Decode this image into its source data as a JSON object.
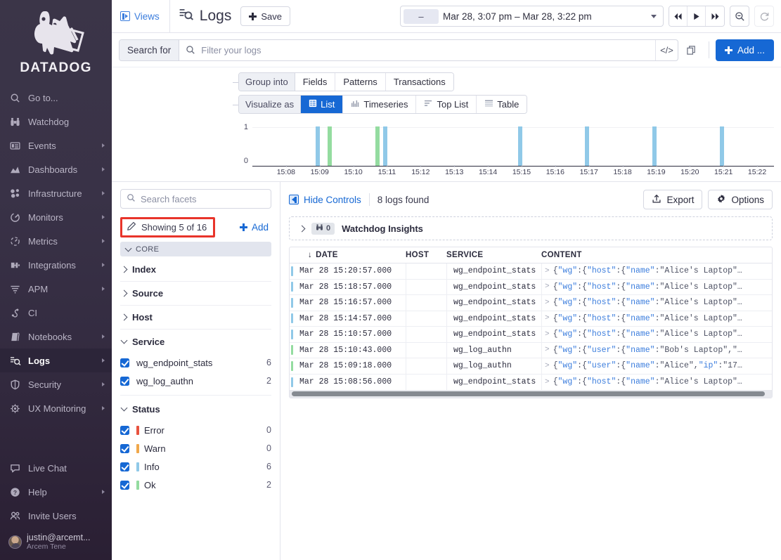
{
  "sidebar": {
    "brand": "DATADOG",
    "items": [
      {
        "label": "Go to...",
        "icon": "search-icon",
        "caret": false,
        "active": false
      },
      {
        "label": "Watchdog",
        "icon": "binoculars-icon",
        "caret": false,
        "active": false
      },
      {
        "label": "Events",
        "icon": "events-icon",
        "caret": true,
        "active": false
      },
      {
        "label": "Dashboards",
        "icon": "dashboards-icon",
        "caret": true,
        "active": false
      },
      {
        "label": "Infrastructure",
        "icon": "infrastructure-icon",
        "caret": true,
        "active": false
      },
      {
        "label": "Monitors",
        "icon": "monitors-icon",
        "caret": true,
        "active": false
      },
      {
        "label": "Metrics",
        "icon": "metrics-icon",
        "caret": true,
        "active": false
      },
      {
        "label": "Integrations",
        "icon": "integrations-icon",
        "caret": true,
        "active": false
      },
      {
        "label": "APM",
        "icon": "apm-icon",
        "caret": true,
        "active": false
      },
      {
        "label": "CI",
        "icon": "ci-icon",
        "caret": false,
        "active": false
      },
      {
        "label": "Notebooks",
        "icon": "notebooks-icon",
        "caret": true,
        "active": false
      },
      {
        "label": "Logs",
        "icon": "logs-icon",
        "caret": true,
        "active": true
      },
      {
        "label": "Security",
        "icon": "shield-icon",
        "caret": true,
        "active": false
      },
      {
        "label": "UX Monitoring",
        "icon": "ux-monitoring-icon",
        "caret": true,
        "active": false
      }
    ],
    "bottom_items": [
      {
        "label": "Live Chat",
        "icon": "chat-icon",
        "caret": false
      },
      {
        "label": "Help",
        "icon": "help-icon",
        "caret": true
      },
      {
        "label": "Invite Users",
        "icon": "invite-users-icon",
        "caret": false
      }
    ],
    "user": {
      "email": "justin@arcemt...",
      "org": "Arcem Tene"
    }
  },
  "topbar": {
    "views_label": "Views",
    "page_title": "Logs",
    "save_label": "Save",
    "time_range_dash": "–",
    "time_range": "Mar 28, 3:07 pm – Mar 28, 3:22 pm"
  },
  "search": {
    "label": "Search for",
    "placeholder": "Filter your logs",
    "value": "",
    "code_icon": "</>",
    "add_label": "Add ..."
  },
  "controls": {
    "group_lead": "Group into",
    "group_options": [
      "Fields",
      "Patterns",
      "Transactions"
    ],
    "group_selected": "",
    "visualize_lead": "Visualize as",
    "visualize_options": [
      {
        "label": "List",
        "icon": "list-icon",
        "selected": true
      },
      {
        "label": "Timeseries",
        "icon": "timeseries-icon",
        "selected": false
      },
      {
        "label": "Top List",
        "icon": "top-list-icon",
        "selected": false
      },
      {
        "label": "Table",
        "icon": "table-icon",
        "selected": false
      }
    ]
  },
  "chart_data": {
    "type": "bar",
    "title": "",
    "xlabel": "",
    "ylabel": "",
    "ylim": [
      0,
      1
    ],
    "ytick_labels": [
      "0",
      "1"
    ],
    "grid": true,
    "xtick_labels": [
      "15:08",
      "15:09",
      "15:10",
      "15:11",
      "15:12",
      "15:13",
      "15:14",
      "15:15",
      "15:16",
      "15:17",
      "15:18",
      "15:19",
      "15:20",
      "15:21",
      "15:22"
    ],
    "x_axis_start": "15:07",
    "x_axis_end": "15:22:30",
    "colors": {
      "info": "#90c9e8",
      "ok": "#94dca0",
      "warn": "#f0a84a",
      "error": "#e8523f"
    },
    "categories": [
      "15:08:56",
      "15:09:18",
      "15:10:43",
      "15:10:57",
      "15:14:57",
      "15:16:57",
      "15:18:57",
      "15:20:57"
    ],
    "values": [
      1,
      1,
      1,
      1,
      1,
      1,
      1,
      1
    ],
    "series": [
      {
        "name": "Info",
        "color": "#90c9e8",
        "points": [
          {
            "x": "15:08:56",
            "y": 1
          },
          {
            "x": "15:10:57",
            "y": 1
          },
          {
            "x": "15:14:57",
            "y": 1
          },
          {
            "x": "15:16:57",
            "y": 1
          },
          {
            "x": "15:18:57",
            "y": 1
          },
          {
            "x": "15:20:57",
            "y": 1
          }
        ]
      },
      {
        "name": "Ok",
        "color": "#94dca0",
        "points": [
          {
            "x": "15:09:18",
            "y": 1
          },
          {
            "x": "15:10:43",
            "y": 1
          }
        ]
      }
    ]
  },
  "facets": {
    "search_placeholder": "Search facets",
    "showing_label": "Showing 5 of 16",
    "add_label": "Add",
    "core_label": "CORE",
    "groups": [
      {
        "label": "Index",
        "open": false
      },
      {
        "label": "Source",
        "open": false
      },
      {
        "label": "Host",
        "open": false
      }
    ],
    "service": {
      "label": "Service",
      "values": [
        {
          "name": "wg_endpoint_stats",
          "count": "6",
          "checked": true
        },
        {
          "name": "wg_log_authn",
          "count": "2",
          "checked": true
        }
      ]
    },
    "status": {
      "label": "Status",
      "values": [
        {
          "name": "Error",
          "count": "0",
          "checked": true,
          "color": "#e8523f"
        },
        {
          "name": "Warn",
          "count": "0",
          "checked": true,
          "color": "#f0a84a"
        },
        {
          "name": "Info",
          "count": "6",
          "checked": true,
          "color": "#90c9e8"
        },
        {
          "name": "Ok",
          "count": "2",
          "checked": true,
          "color": "#94dca0"
        }
      ]
    }
  },
  "logs_panel": {
    "hide_controls_label": "Hide Controls",
    "count_label": "8 logs found",
    "export_label": "Export",
    "options_label": "Options",
    "watchdog": {
      "badge_count": "0",
      "title": "Watchdog Insights"
    },
    "columns": [
      "DATE",
      "HOST",
      "SERVICE",
      "CONTENT"
    ],
    "sort_indicator": "↓",
    "rows": [
      {
        "date": "Mar 28 15:20:57.000",
        "host": "",
        "service": "wg_endpoint_stats",
        "status_color": "#90c9e8",
        "content_parts": [
          {
            "t": "{",
            "c": "brace"
          },
          {
            "t": "\"wg\"",
            "c": "key"
          },
          {
            "t": ":{",
            "c": "brace"
          },
          {
            "t": "\"host\"",
            "c": "key"
          },
          {
            "t": ":{",
            "c": "brace"
          },
          {
            "t": "\"name\"",
            "c": "key"
          },
          {
            "t": ":",
            "c": "brace"
          },
          {
            "t": "\"Alice's Laptop\"…",
            "c": "str"
          }
        ]
      },
      {
        "date": "Mar 28 15:18:57.000",
        "host": "",
        "service": "wg_endpoint_stats",
        "status_color": "#90c9e8",
        "content_parts": [
          {
            "t": "{",
            "c": "brace"
          },
          {
            "t": "\"wg\"",
            "c": "key"
          },
          {
            "t": ":{",
            "c": "brace"
          },
          {
            "t": "\"host\"",
            "c": "key"
          },
          {
            "t": ":{",
            "c": "brace"
          },
          {
            "t": "\"name\"",
            "c": "key"
          },
          {
            "t": ":",
            "c": "brace"
          },
          {
            "t": "\"Alice's Laptop\"…",
            "c": "str"
          }
        ]
      },
      {
        "date": "Mar 28 15:16:57.000",
        "host": "",
        "service": "wg_endpoint_stats",
        "status_color": "#90c9e8",
        "content_parts": [
          {
            "t": "{",
            "c": "brace"
          },
          {
            "t": "\"wg\"",
            "c": "key"
          },
          {
            "t": ":{",
            "c": "brace"
          },
          {
            "t": "\"host\"",
            "c": "key"
          },
          {
            "t": ":{",
            "c": "brace"
          },
          {
            "t": "\"name\"",
            "c": "key"
          },
          {
            "t": ":",
            "c": "brace"
          },
          {
            "t": "\"Alice's Laptop\"…",
            "c": "str"
          }
        ]
      },
      {
        "date": "Mar 28 15:14:57.000",
        "host": "",
        "service": "wg_endpoint_stats",
        "status_color": "#90c9e8",
        "content_parts": [
          {
            "t": "{",
            "c": "brace"
          },
          {
            "t": "\"wg\"",
            "c": "key"
          },
          {
            "t": ":{",
            "c": "brace"
          },
          {
            "t": "\"host\"",
            "c": "key"
          },
          {
            "t": ":{",
            "c": "brace"
          },
          {
            "t": "\"name\"",
            "c": "key"
          },
          {
            "t": ":",
            "c": "brace"
          },
          {
            "t": "\"Alice's Laptop\"…",
            "c": "str"
          }
        ]
      },
      {
        "date": "Mar 28 15:10:57.000",
        "host": "",
        "service": "wg_endpoint_stats",
        "status_color": "#90c9e8",
        "content_parts": [
          {
            "t": "{",
            "c": "brace"
          },
          {
            "t": "\"wg\"",
            "c": "key"
          },
          {
            "t": ":{",
            "c": "brace"
          },
          {
            "t": "\"host\"",
            "c": "key"
          },
          {
            "t": ":{",
            "c": "brace"
          },
          {
            "t": "\"name\"",
            "c": "key"
          },
          {
            "t": ":",
            "c": "brace"
          },
          {
            "t": "\"Alice's Laptop\"…",
            "c": "str"
          }
        ]
      },
      {
        "date": "Mar 28 15:10:43.000",
        "host": "",
        "service": "wg_log_authn",
        "status_color": "#94dca0",
        "content_parts": [
          {
            "t": "{",
            "c": "brace"
          },
          {
            "t": "\"wg\"",
            "c": "key"
          },
          {
            "t": ":{",
            "c": "brace"
          },
          {
            "t": "\"user\"",
            "c": "key"
          },
          {
            "t": ":{",
            "c": "brace"
          },
          {
            "t": "\"name\"",
            "c": "key"
          },
          {
            "t": ":",
            "c": "brace"
          },
          {
            "t": "\"Bob's Laptop\",\"…",
            "c": "str"
          }
        ]
      },
      {
        "date": "Mar 28 15:09:18.000",
        "host": "",
        "service": "wg_log_authn",
        "status_color": "#94dca0",
        "content_parts": [
          {
            "t": "{",
            "c": "brace"
          },
          {
            "t": "\"wg\"",
            "c": "key"
          },
          {
            "t": ":{",
            "c": "brace"
          },
          {
            "t": "\"user\"",
            "c": "key"
          },
          {
            "t": ":{",
            "c": "brace"
          },
          {
            "t": "\"name\"",
            "c": "key"
          },
          {
            "t": ":",
            "c": "brace"
          },
          {
            "t": "\"Alice\",",
            "c": "str"
          },
          {
            "t": "\"ip\"",
            "c": "key"
          },
          {
            "t": ":",
            "c": "brace"
          },
          {
            "t": "\"17…",
            "c": "str"
          }
        ]
      },
      {
        "date": "Mar 28 15:08:56.000",
        "host": "",
        "service": "wg_endpoint_stats",
        "status_color": "#90c9e8",
        "content_parts": [
          {
            "t": "{",
            "c": "brace"
          },
          {
            "t": "\"wg\"",
            "c": "key"
          },
          {
            "t": ":{",
            "c": "brace"
          },
          {
            "t": "\"host\"",
            "c": "key"
          },
          {
            "t": ":{",
            "c": "brace"
          },
          {
            "t": "\"name\"",
            "c": "key"
          },
          {
            "t": ":",
            "c": "brace"
          },
          {
            "t": "\"Alice's Laptop\"…",
            "c": "str"
          }
        ]
      }
    ]
  }
}
